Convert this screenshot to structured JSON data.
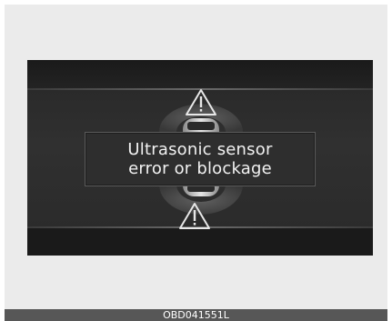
{
  "cluster_display": {
    "warning_message": {
      "line1": "Ultrasonic sensor",
      "line2": "error or blockage"
    },
    "icons": {
      "front_warning": "warning-triangle-icon",
      "rear_warning": "warning-triangle-icon",
      "vehicle": "car-top-view-icon"
    }
  },
  "figure_code": "OBD041551L",
  "colors": {
    "screen_bg": "#141414",
    "message_text": "#f2f2f2",
    "footer_bg": "#575757"
  }
}
